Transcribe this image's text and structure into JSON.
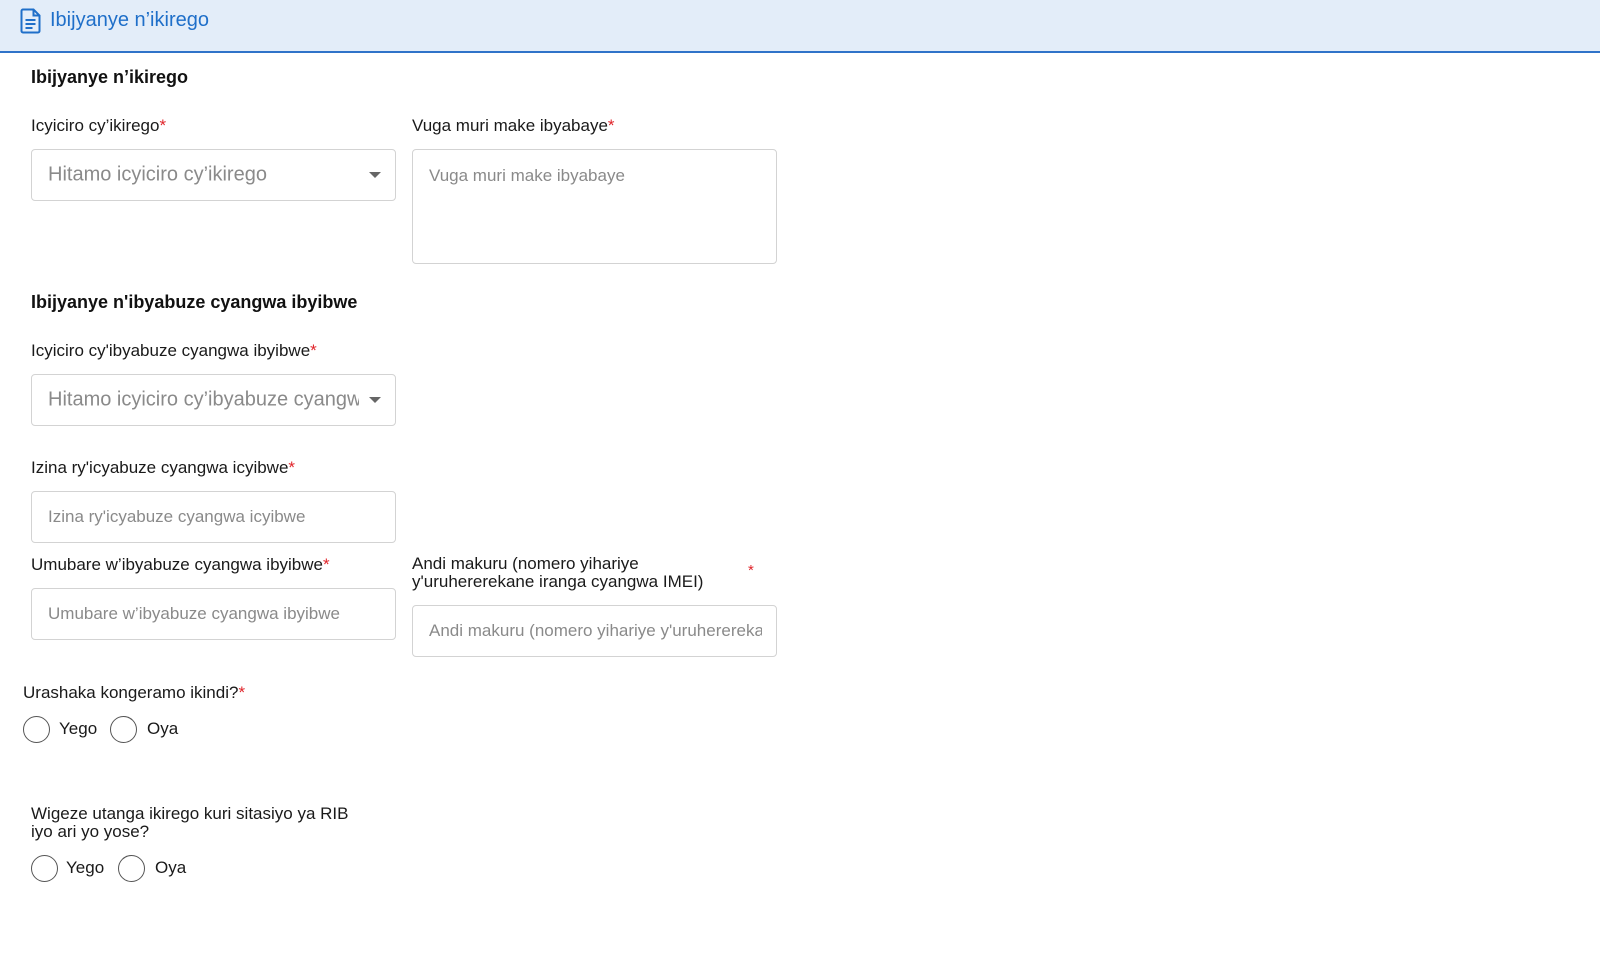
{
  "header": {
    "icon": "document-icon",
    "title": "Ibijyanye n’ikirego"
  },
  "section1": {
    "title": "Ibijyanye n’ikirego",
    "category": {
      "label": "Icyiciro cy’ikirego",
      "required_mark": "*",
      "placeholder": "Hitamo icyiciro cy’ikirego"
    },
    "description": {
      "label": "Vuga muri make ibyabaye",
      "required_mark": "*",
      "placeholder": "Vuga muri make ibyabaye"
    }
  },
  "section2": {
    "title": "Ibijyanye n'ibyabuze cyangwa ibyibwe",
    "item_category": {
      "label": "Icyiciro cy'ibyabuze cyangwa ibyibwe",
      "required_mark": "*",
      "placeholder": "Hitamo icyiciro cy’ibyabuze cyangwa ibyibwe"
    },
    "item_name": {
      "label": "Izina ry'icyabuze cyangwa icyibwe",
      "required_mark": "*",
      "placeholder": "Izina ry'icyabuze cyangwa icyibwe"
    },
    "item_count": {
      "label": "Umubare w’ibyabuze cyangwa ibyibwe",
      "required_mark": "*",
      "placeholder": "Umubare w’ibyabuze cyangwa ibyibwe"
    },
    "other_info": {
      "label_line1": "Andi makuru (nomero yihariye",
      "label_line2": "y'uruhererekane iranga cyangwa IMEI)",
      "required_mark": "*",
      "placeholder": "Andi makuru (nomero yihariye y'uruhererekane iranga cyangwa IMEI)"
    }
  },
  "add_more": {
    "question": "Urashaka kongeramo ikindi?",
    "required_mark": "*",
    "yes": "Yego",
    "no": "Oya"
  },
  "rib_station": {
    "question_line1": "Wigeze utanga ikirego kuri sitasiyo ya RIB",
    "question_line2": "iyo ari yo yose?",
    "yes": "Yego",
    "no": "Oya"
  }
}
